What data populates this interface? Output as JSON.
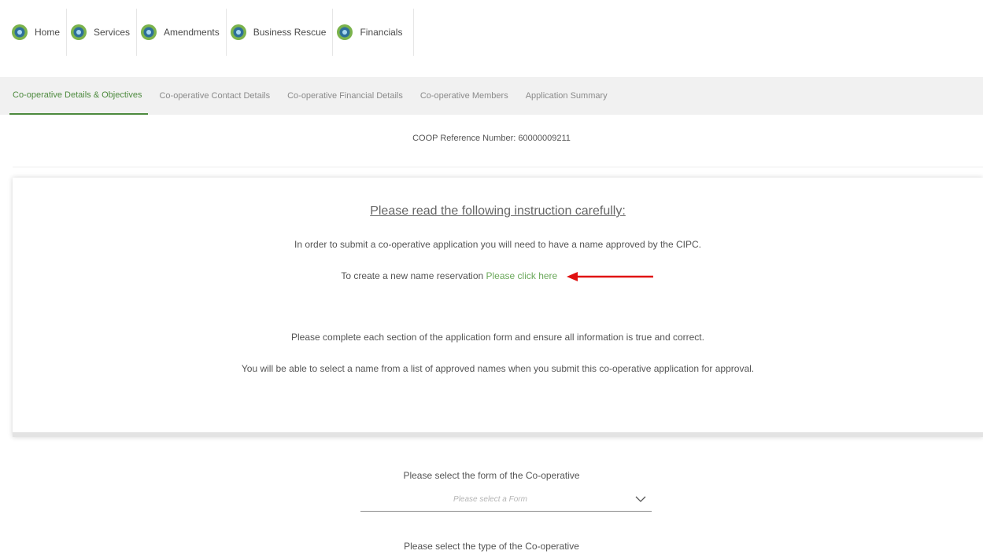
{
  "top_nav": {
    "items": [
      {
        "label": "Home",
        "icon": "cipc-logo-icon"
      },
      {
        "label": "Services",
        "icon": "cipc-logo-icon"
      },
      {
        "label": "Amendments",
        "icon": "cipc-logo-icon"
      },
      {
        "label": "Business Rescue",
        "icon": "cipc-logo-icon"
      },
      {
        "label": "Financials",
        "icon": "cipc-logo-icon"
      }
    ]
  },
  "tabs": [
    {
      "label": "Co-operative Details & Objectives",
      "active": true
    },
    {
      "label": "Co-operative Contact Details",
      "active": false
    },
    {
      "label": "Co-operative Financial Details",
      "active": false
    },
    {
      "label": "Co-operative Members",
      "active": false
    },
    {
      "label": "Application Summary",
      "active": false
    }
  ],
  "reference": {
    "text": "COOP Reference Number: 60000009211"
  },
  "instructions": {
    "heading": "Please read the following instruction carefully:",
    "line1": "In order to submit a co-operative application you will need to have a name approved by the CIPC.",
    "reservation_prefix": "To create a new name reservation",
    "reservation_link": "Please click here",
    "line3": "Please complete each section of the application form and ensure all information is true and correct.",
    "line4": "You will be able to select a name from a list of approved names when you submit this co-operative application for approval."
  },
  "form": {
    "form_label": "Please select the form of the Co-operative",
    "form_placeholder": "Please select a Form",
    "type_label": "Please select the type of the Co-operative"
  },
  "colors": {
    "accent_green": "#4d8a3e",
    "link_green": "#6aa85a",
    "annotation_arrow": "#e01010",
    "tab_bar_bg": "#f1f1f1"
  }
}
